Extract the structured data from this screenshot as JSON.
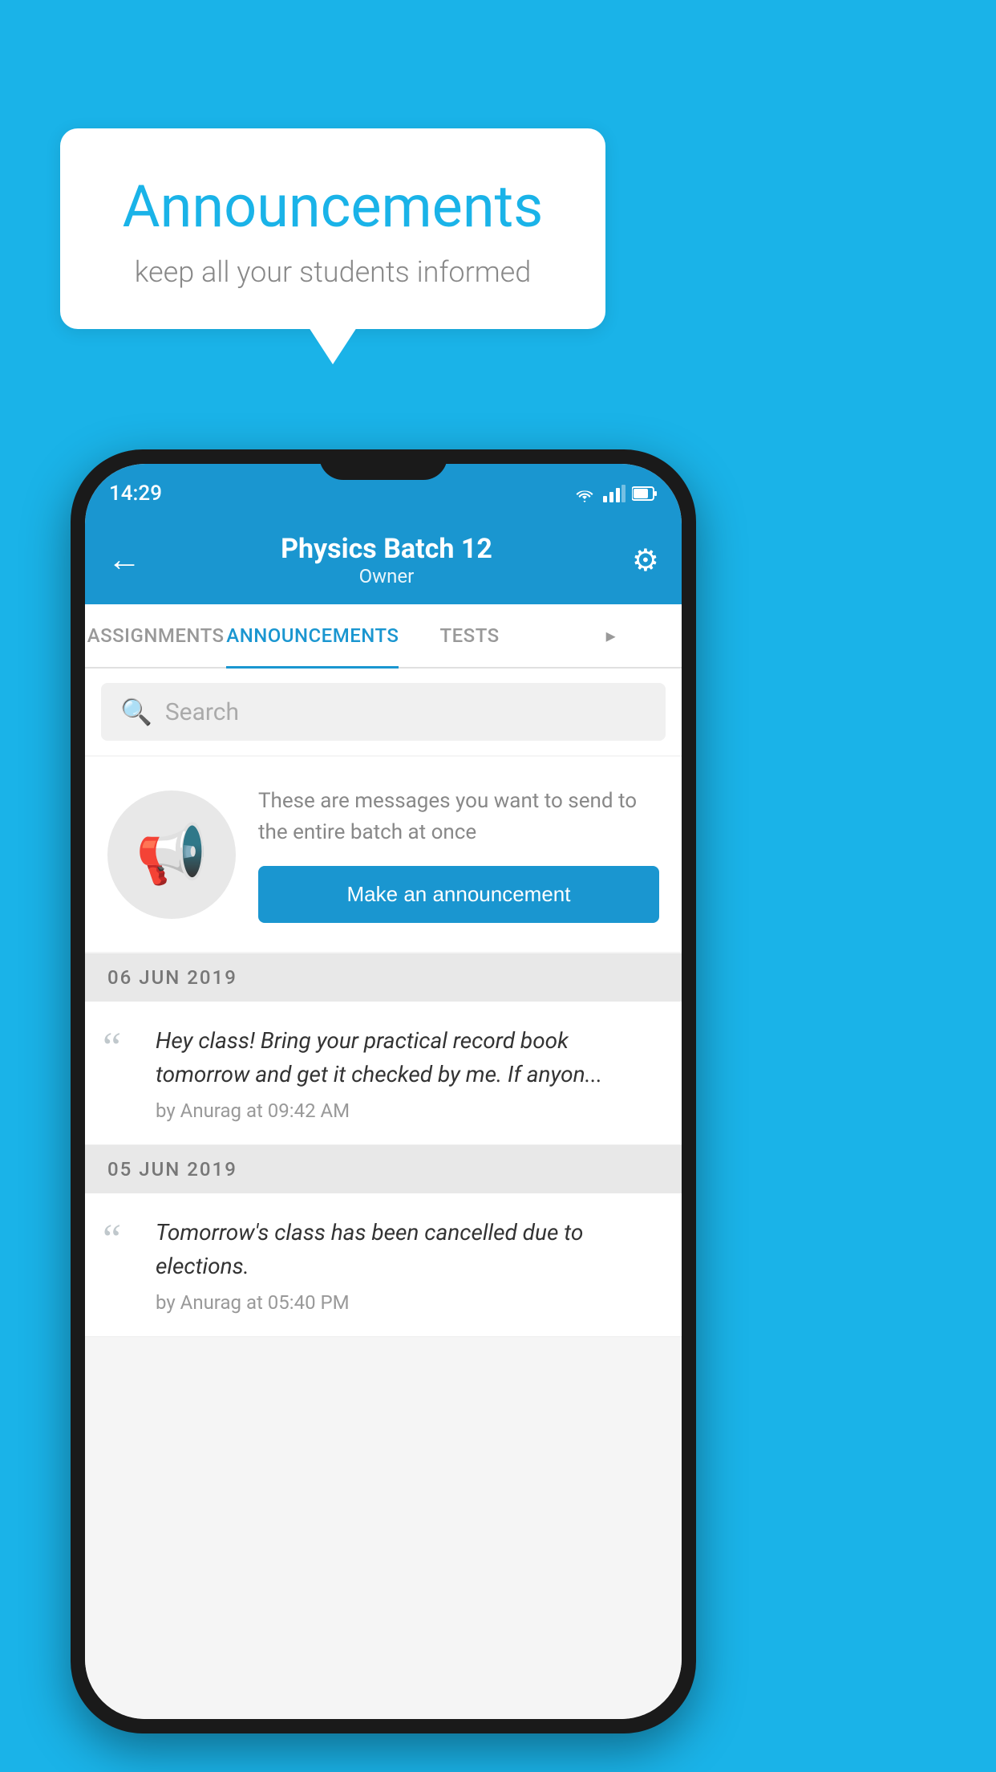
{
  "background_color": "#1ab3e8",
  "speech_bubble": {
    "title": "Announcements",
    "subtitle": "keep all your students informed"
  },
  "phone": {
    "status_bar": {
      "time": "14:29"
    },
    "app_bar": {
      "title": "Physics Batch 12",
      "subtitle": "Owner",
      "back_label": "←",
      "gear_label": "⚙"
    },
    "tabs": [
      {
        "label": "ASSIGNMENTS",
        "active": false
      },
      {
        "label": "ANNOUNCEMENTS",
        "active": true
      },
      {
        "label": "TESTS",
        "active": false
      },
      {
        "label": "···",
        "active": false
      }
    ],
    "search": {
      "placeholder": "Search"
    },
    "promo": {
      "description": "These are messages you want to send to the entire batch at once",
      "button_label": "Make an announcement"
    },
    "announcements": [
      {
        "date": "06  JUN  2019",
        "text": "Hey class! Bring your practical record book tomorrow and get it checked by me. If anyon...",
        "meta": "by Anurag at 09:42 AM"
      },
      {
        "date": "05  JUN  2019",
        "text": "Tomorrow's class has been cancelled due to elections.",
        "meta": "by Anurag at 05:40 PM"
      }
    ]
  }
}
